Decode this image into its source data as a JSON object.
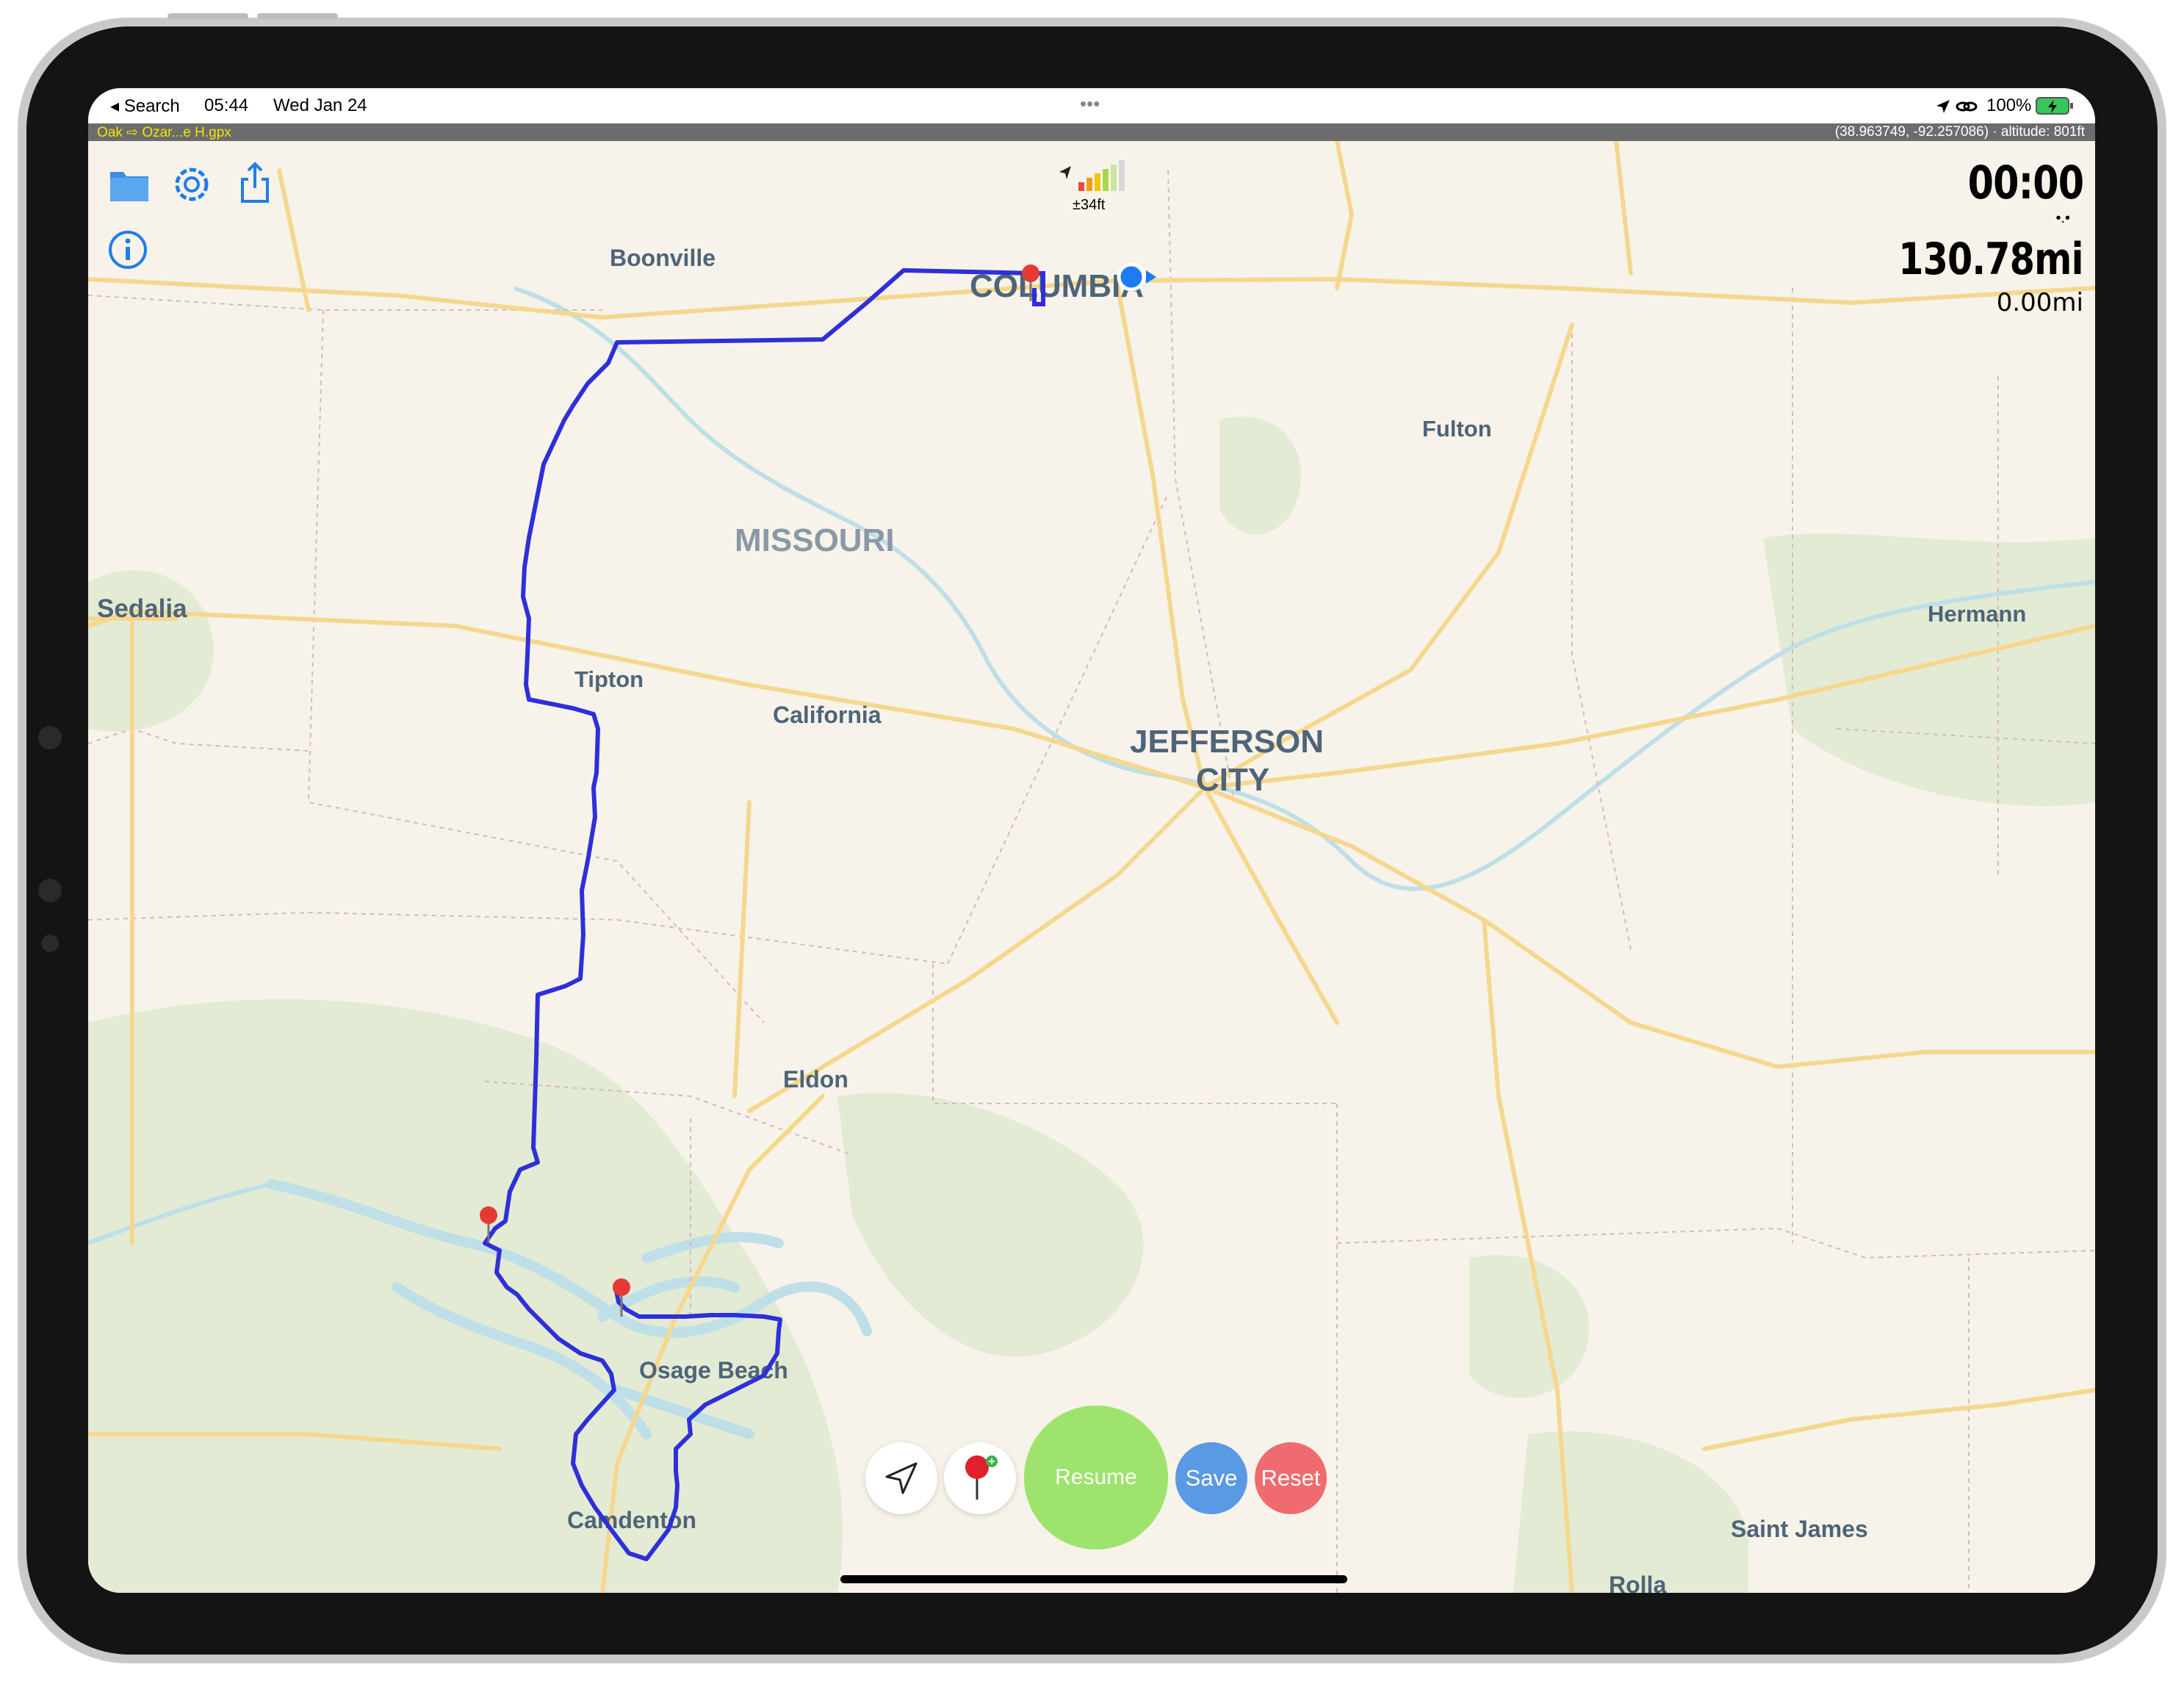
{
  "status_bar": {
    "back_label": "◂ Search",
    "time": "05:44",
    "date": "Wed Jan 24",
    "more": "•••",
    "battery": "100%"
  },
  "file_bar": {
    "file_name": "Oak ⇨ Ozar...e H.gpx",
    "coordinates": "(38.963749, -92.257086) · altitude: 801ft"
  },
  "toolbar": {
    "folder_icon": "folder-icon",
    "settings_icon": "gear-icon",
    "share_icon": "share-icon",
    "info_icon": "info-icon"
  },
  "gps": {
    "accuracy": "±34ft"
  },
  "hud": {
    "timer": "00:00",
    "dots": "•.•",
    "distance_total": "130.78mi",
    "distance_current": "0.00mi"
  },
  "map": {
    "labels": {
      "boonville": "Boonville",
      "columbia": "COLUMBIA",
      "fulton": "Fulton",
      "missouri": "MISSOURI",
      "sedalia": "Sedalia",
      "hermann": "Hermann",
      "tipton": "Tipton",
      "california": "California",
      "jefferson_1": "JEFFERSON",
      "jefferson_2": "CITY",
      "eldon": "Eldon",
      "osage_beach": "Osage Beach",
      "camdenton": "Camdenton",
      "saint_james": "Saint James",
      "rolla": "Rolla"
    },
    "colors": {
      "route": "#2f2fd9",
      "land": "#f7f3ea",
      "road": "#f6d78e",
      "water": "#bfdfe8",
      "forest": "#dfe9d0",
      "pin": "#e53935"
    }
  },
  "controls": {
    "resume_label": "Resume",
    "save_label": "Save",
    "reset_label": "Reset"
  }
}
